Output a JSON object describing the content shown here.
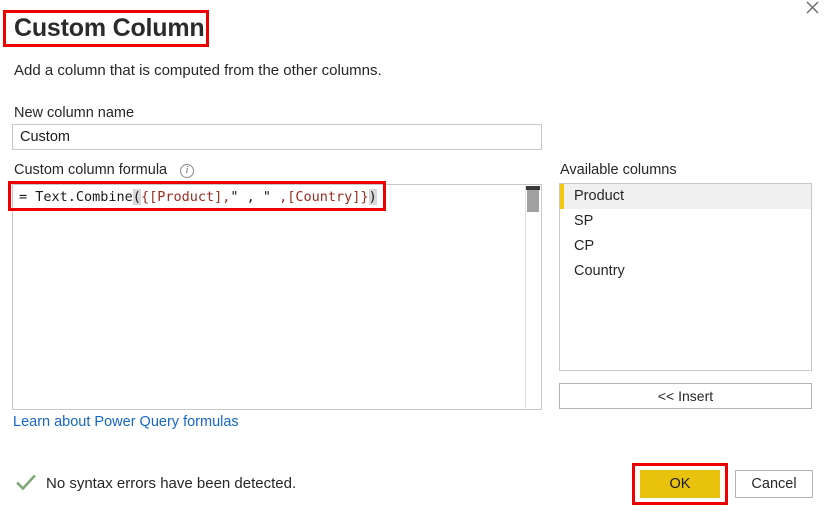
{
  "dialog": {
    "title": "Custom Column",
    "subtitle": "Add a column that is computed from the other columns.",
    "close_icon": "close-icon"
  },
  "new_column": {
    "label": "New column name",
    "value": "Custom",
    "placeholder": ""
  },
  "formula": {
    "label": "Custom column formula",
    "info_icon": "i",
    "value": "= Text.Combine({[Product],\" , \" ,[Country]})",
    "tokens": [
      {
        "text": "= Text.Combine",
        "kind": "plain"
      },
      {
        "text": "(",
        "kind": "plain",
        "selected": true
      },
      {
        "text": "{",
        "kind": "bracket"
      },
      {
        "text": "[Product]",
        "kind": "bracket"
      },
      {
        "text": ",",
        "kind": "bracket"
      },
      {
        "text": "\" , \"",
        "kind": "plain"
      },
      {
        "text": " ,",
        "kind": "bracket"
      },
      {
        "text": "[Country]",
        "kind": "bracket"
      },
      {
        "text": "}",
        "kind": "bracket"
      },
      {
        "text": ")",
        "kind": "plain",
        "selected": true
      }
    ]
  },
  "learn_link": "Learn about Power Query formulas",
  "status": {
    "text": "No syntax errors have been detected.",
    "icon": "check-icon",
    "color": "#7fa878"
  },
  "available_columns": {
    "label": "Available columns",
    "items": [
      {
        "label": "Product",
        "selected": true
      },
      {
        "label": "SP",
        "selected": false
      },
      {
        "label": "CP",
        "selected": false
      },
      {
        "label": "Country",
        "selected": false
      }
    ]
  },
  "buttons": {
    "insert": "<< Insert",
    "ok": "OK",
    "cancel": "Cancel"
  },
  "colors": {
    "accent_gold": "#f2c811",
    "ok_button": "#e9c20e",
    "link_blue": "#1666c6",
    "annotation_red": "#ee0000",
    "check_green": "#7fa878"
  }
}
